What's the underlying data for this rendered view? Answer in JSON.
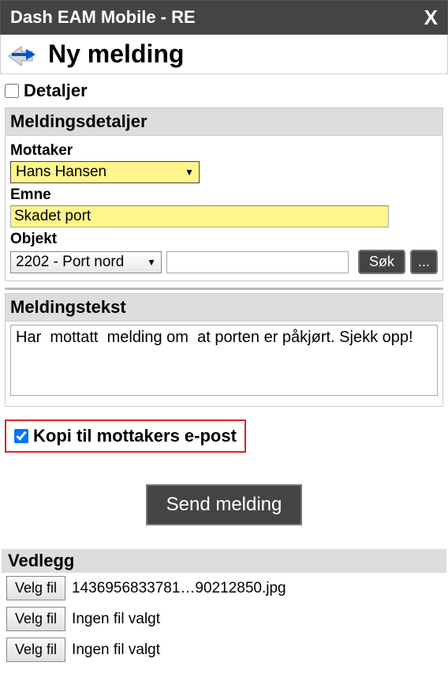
{
  "titlebar": {
    "title": "Dash EAM Mobile - RE",
    "close": "X"
  },
  "page": {
    "heading": "Ny melding"
  },
  "details": {
    "label": "Detaljer",
    "checked": false
  },
  "section1": {
    "title": "Meldingsdetaljer",
    "recipient_label": "Mottaker",
    "recipient_value": "Hans Hansen",
    "subject_label": "Emne",
    "subject_value": "Skadet port",
    "object_label": "Objekt",
    "object_value": "2202 - Port nord",
    "object_input": "",
    "search_btn": "Søk",
    "more_btn": "..."
  },
  "section2": {
    "title": "Meldingstekst",
    "body": "Har  mottatt  melding om  at porten er påkjørt. Sjekk opp!"
  },
  "copy": {
    "label": "Kopi til mottakers e-post",
    "checked": true
  },
  "send": {
    "label": "Send melding"
  },
  "attach": {
    "title": "Vedlegg",
    "choose": "Velg fil",
    "none": "Ingen fil valgt",
    "files": [
      "1436956833781…90212850.jpg",
      "Ingen fil valgt",
      "Ingen fil valgt"
    ]
  }
}
